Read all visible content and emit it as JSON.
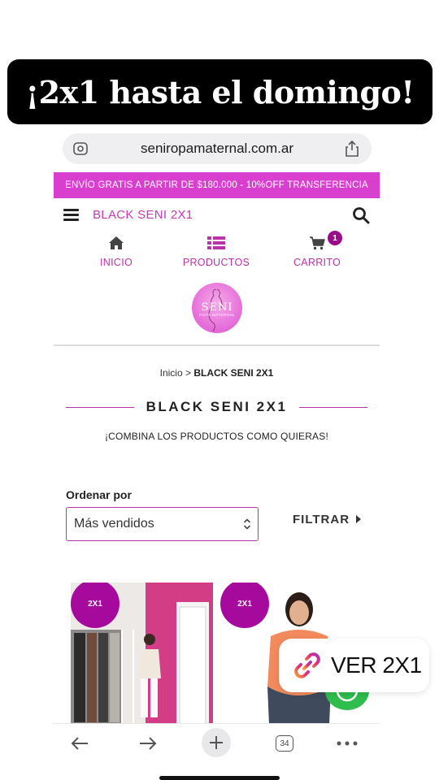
{
  "story": {
    "title": "¡2x1 hasta el domingo!"
  },
  "browser": {
    "url": "seniropamaternal.com.ar",
    "tab_count": "34"
  },
  "promo_bar": {
    "text": "ENVÍO GRATIS A PARTIR DE $180.000 - 10%OFF TRANSFERENCIA"
  },
  "header": {
    "brand": "BLACK SENI 2X1"
  },
  "nav": {
    "items": [
      {
        "label": "INICIO",
        "icon": "home-icon"
      },
      {
        "label": "PRODUCTOS",
        "icon": "list-icon"
      },
      {
        "label": "CARRITO",
        "icon": "cart-icon",
        "badge": "1"
      }
    ]
  },
  "logo": {
    "line1": "SENI",
    "line2": "ROPA MATERNAL"
  },
  "breadcrumb": {
    "home": "Inicio",
    "separator": " > ",
    "current": "BLACK SENI 2X1"
  },
  "category": {
    "title": "BLACK SENI 2X1",
    "subtitle": "¡COMBINA LOS PRODUCTOS COMO QUIERAS!"
  },
  "sort": {
    "label": "Ordenar por",
    "selected": "Más vendidos"
  },
  "filter": {
    "label": "FILTRAR"
  },
  "products": [
    {
      "badge": "2X1"
    },
    {
      "badge": "2X1"
    }
  ],
  "sticker": {
    "text": "VER 2X1"
  },
  "colors": {
    "accent": "#d93fcf",
    "brand_text": "#b734a9",
    "badge": "#a50a9c",
    "whatsapp": "#2fbd4e"
  }
}
